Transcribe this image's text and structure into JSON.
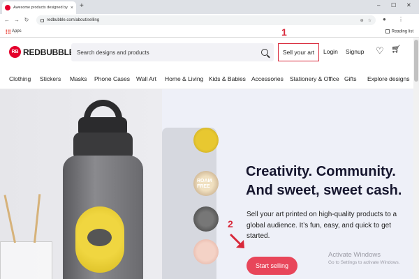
{
  "browser": {
    "tab_title": "Awesome products designed by",
    "tab_close": "×",
    "new_tab": "+",
    "url": "redbubble.com/about/selling",
    "bookmarks": {
      "apps": "Apps",
      "reading_list": "Reading list"
    },
    "win_min": "–",
    "win_max": "☐",
    "win_close": "✕"
  },
  "header": {
    "logo_badge": "RB",
    "logo_text": "REDBUBBLE",
    "search_placeholder": "Search designs and products",
    "sell_button": "Sell your art",
    "login": "Login",
    "signup": "Signup",
    "annotation_1": "1"
  },
  "categories": [
    "Clothing",
    "Stickers",
    "Masks",
    "Phone Cases",
    "Wall Art",
    "Home & Living",
    "Kids & Babies",
    "Accessories",
    "Stationery & Office",
    "Gifts",
    "Explore designs"
  ],
  "hero": {
    "headline_line1": "Creativity. Community.",
    "headline_line2": "And sweet, sweet cash.",
    "subtext": "Sell your art printed on high-quality products to a global audience. It’s fun, easy, and quick to get started.",
    "cta": "Start selling",
    "annotation_2": "2",
    "disc_text_1": "ROAM",
    "disc_text_2": "FREE"
  },
  "watermark": {
    "line1": "Activate Windows",
    "line2": "Go to Settings to activate Windows."
  },
  "colors": {
    "brand_red": "#e4002b",
    "annotation_red": "#d8283a",
    "cta_pink": "#e8465a"
  }
}
